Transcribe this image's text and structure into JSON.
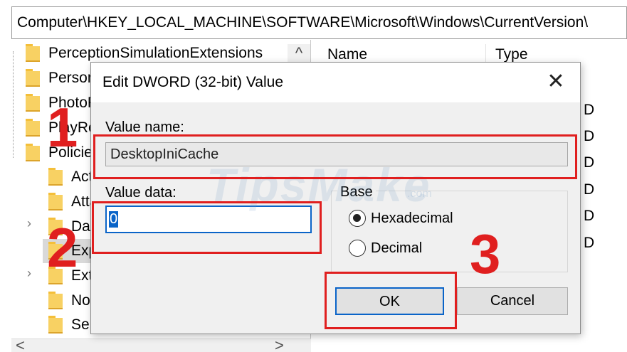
{
  "address_bar": {
    "path": "Computer\\HKEY_LOCAL_MACHINE\\SOFTWARE\\Microsoft\\Windows\\CurrentVersion\\"
  },
  "tree": {
    "items": [
      {
        "label": "PerceptionSimulationExtensions"
      },
      {
        "label": "Personalization"
      },
      {
        "label": "PhotoPropertyHandler"
      },
      {
        "label": "PlayReady"
      },
      {
        "label": "Policies"
      },
      {
        "label": "ActiveDesktop"
      },
      {
        "label": "Attachments"
      },
      {
        "label": "DataCollection"
      },
      {
        "label": "Explorer"
      },
      {
        "label": "Ext"
      },
      {
        "label": "NonEnum"
      },
      {
        "label": "Servicing"
      }
    ],
    "scroll_up_glyph": "^",
    "scroll_left_glyph": "<",
    "scroll_right_glyph": ">"
  },
  "list": {
    "col_name": "Name",
    "col_type": "Type",
    "type_letters": [
      "D",
      "D",
      "D",
      "D",
      "D",
      "D"
    ]
  },
  "dialog": {
    "title": "Edit DWORD (32-bit) Value",
    "close_glyph": "✕",
    "value_name_label": "Value name:",
    "value_name": "DesktopIniCache",
    "value_data_label": "Value data:",
    "value_data": "0",
    "base_label": "Base",
    "radio_hex": "Hexadecimal",
    "radio_dec": "Decimal",
    "ok_label": "OK",
    "cancel_label": "Cancel"
  },
  "annotations": {
    "step1": "1",
    "step2": "2",
    "step3": "3"
  },
  "watermark": {
    "text": "TipsMake",
    "suffix": ".com"
  },
  "colors": {
    "annotation_red": "#e01f1f",
    "focus_blue": "#0a64c8",
    "folder_yellow": "#f8d163"
  }
}
